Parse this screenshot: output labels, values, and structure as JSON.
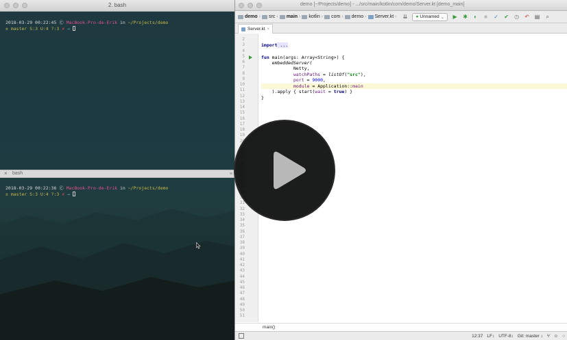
{
  "terminal": {
    "window_title": "2. bash",
    "bottom_pane_title": "bash",
    "top_pane": {
      "prompt_line": {
        "timestamp": "2018-03-29 00:22:45",
        "symbol": "Ⓒ",
        "host": "MacBook-Pro-de-Erik",
        "in_word": "in",
        "path": "~/Projects/demo"
      },
      "git_line": {
        "prefix": "±",
        "branch": "master",
        "status": "S:3 U:4 ?:3",
        "mark": "✗",
        "arrow": "→"
      }
    },
    "bottom_pane": {
      "prompt_line": {
        "timestamp": "2018-03-29 00:22:36",
        "symbol": "Ⓒ",
        "host": "MacBook-Pro-de-Erik",
        "in_word": "in",
        "path": "~/Projects/demo"
      },
      "git_line": {
        "prefix": "±",
        "branch": "master",
        "status": "S:3 U:4 ?:3",
        "mark": "✗",
        "arrow": "→"
      }
    }
  },
  "ide": {
    "window_title": "demo [~/Projects/demo] - .../src/main/kotlin/com/demo/Server.kt [demo_main]",
    "breadcrumbs": [
      "demo",
      "src",
      "main",
      "kotlin",
      "com",
      "demo",
      "Server.kt"
    ],
    "run_config": "Unnamed",
    "tab_label": "Server.kt",
    "line_numbers": [
      "2",
      "3",
      "4",
      "5",
      "6",
      "7",
      "8",
      "9",
      "10",
      "11",
      "12",
      "13",
      "14",
      "15",
      "16",
      "17",
      "18",
      "19",
      "20",
      "21",
      "22",
      "23",
      "24",
      "25",
      "26",
      "27",
      "28",
      "29",
      "30",
      "31",
      "32",
      "33",
      "34",
      "35",
      "36",
      "37",
      "38",
      "39",
      "40",
      "41",
      "42",
      "43",
      "44",
      "45",
      "46",
      "47",
      "48",
      "49",
      "50",
      "51"
    ],
    "code": {
      "import_kw": "import",
      "import_rest": " ...",
      "fun_kw": "fun",
      "main_sig": " main(args: Array<String>) {",
      "embedded": "    embeddedServer(",
      "netty": "            Netty,",
      "watch_name": "            watchPaths",
      "watch_eq": " = ",
      "listof": "listOf",
      "watch_open": "(",
      "watch_str": "\"src\"",
      "watch_close": "),",
      "port_name": "            port",
      "port_eq": " = ",
      "port_num": "9000",
      "port_comma": ",",
      "module_name": "            module",
      "module_rest": " = Application::",
      "module_main": "main",
      "apply_a": "    ).apply { start(",
      "apply_wait": "wait",
      "apply_eq": " = ",
      "apply_true": "true",
      "apply_b": ") }",
      "close_brace": "}"
    },
    "breadcrumb_bottom": "main()",
    "status": {
      "position": "12:37",
      "line_sep": "LF↕",
      "encoding": "UTF-8↕",
      "git": "Git: master ↕"
    },
    "colors": {
      "keyword": "#000080",
      "string": "#008000",
      "number": "#0000ff",
      "param": "#660e7a",
      "highlight": "#fbf8d6"
    }
  },
  "overlay": {
    "icon": "play-icon"
  }
}
